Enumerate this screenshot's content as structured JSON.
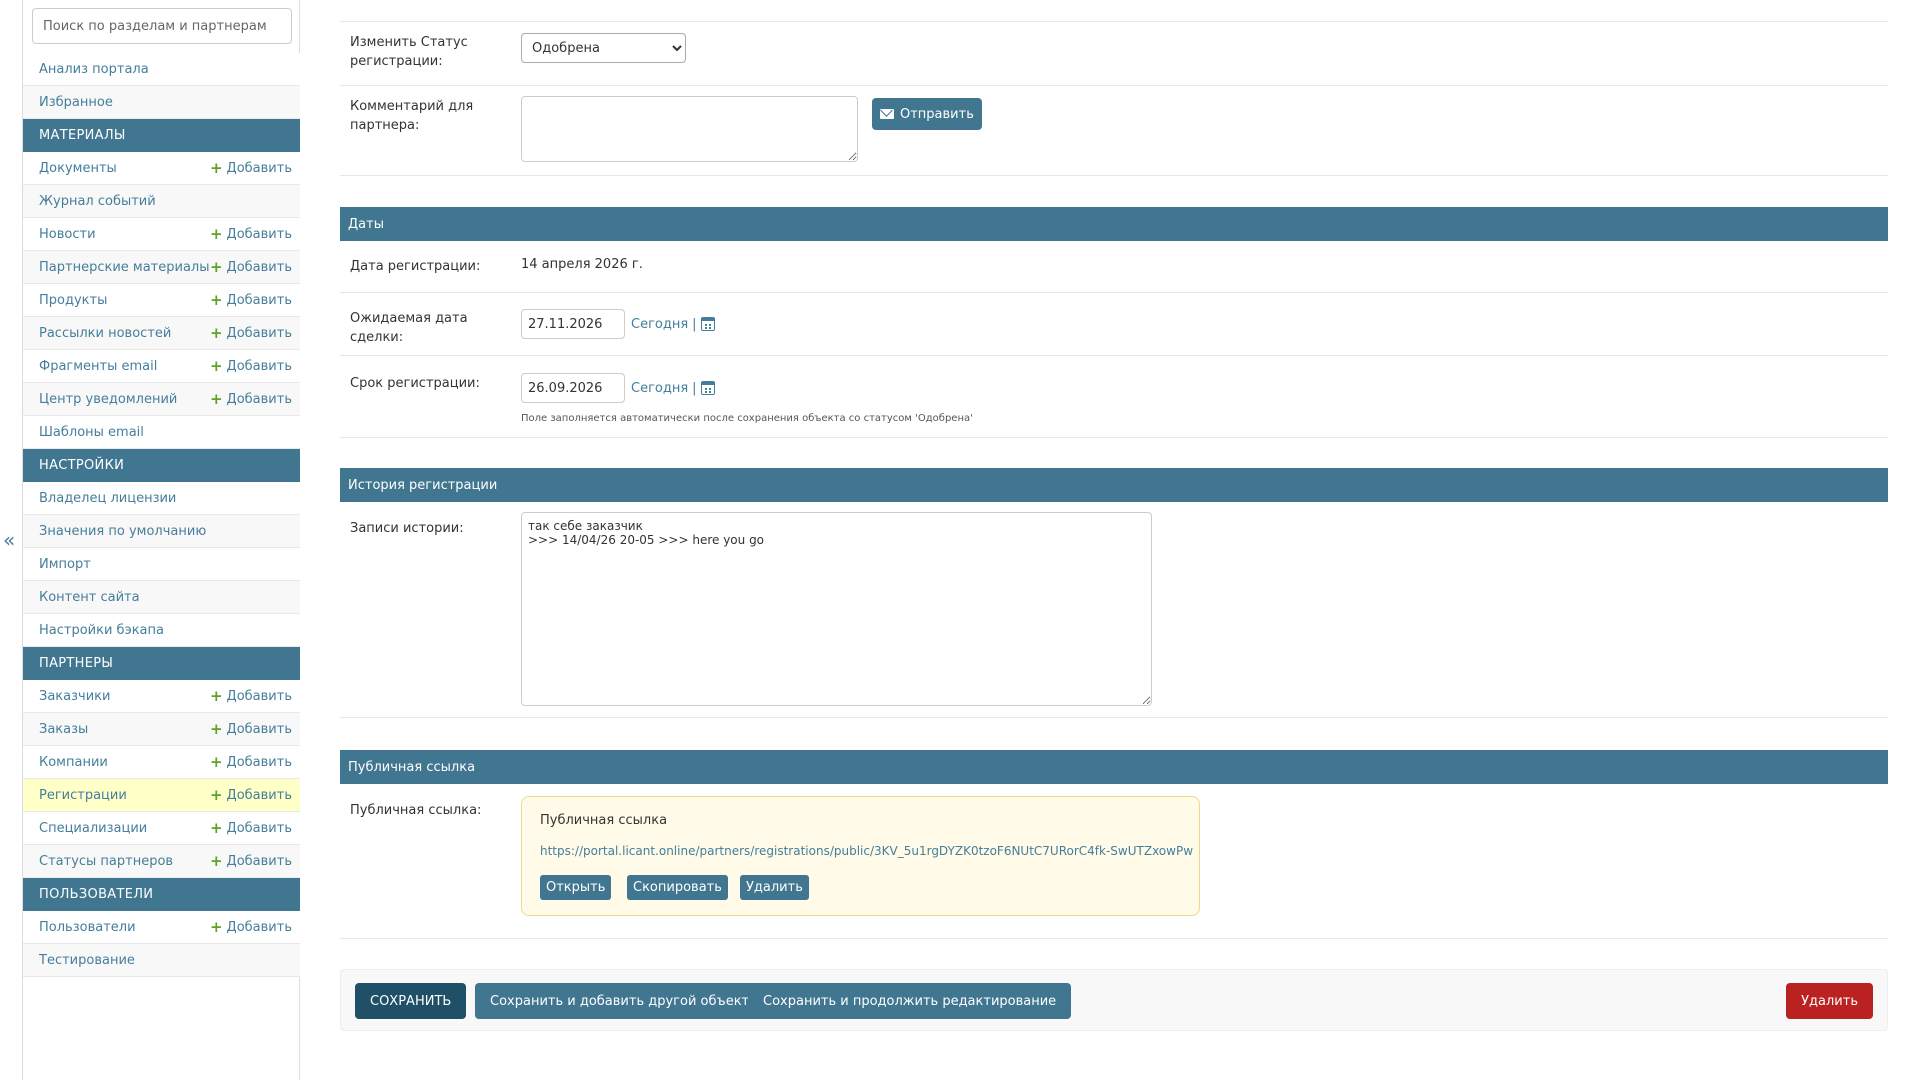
{
  "sidebar": {
    "search_placeholder": "Поиск по разделам и партнерам",
    "collapse_label": "«",
    "add_label": "Добавить",
    "top_items": [
      {
        "label": "Анализ портала"
      },
      {
        "label": "Избранное"
      }
    ],
    "groups": [
      {
        "title": "МАТЕРИАЛЫ",
        "items": [
          {
            "label": "Документы"
          },
          {
            "label": "Журнал событий"
          },
          {
            "label": "Новости"
          },
          {
            "label": "Партнерские материалы"
          },
          {
            "label": "Продукты"
          },
          {
            "label": "Рассылки новостей"
          },
          {
            "label": "Фрагменты email"
          },
          {
            "label": "Центр уведомлений"
          },
          {
            "label": "Шаблоны email"
          }
        ]
      },
      {
        "title": "НАСТРОЙКИ",
        "items": [
          {
            "label": "Владелец лицензии"
          },
          {
            "label": "Значения по умолчанию"
          },
          {
            "label": "Импорт"
          },
          {
            "label": "Контент сайта"
          },
          {
            "label": "Настройки бэкапа"
          }
        ]
      },
      {
        "title": "ПАРТНЕРЫ",
        "items": [
          {
            "label": "Заказчики"
          },
          {
            "label": "Заказы"
          },
          {
            "label": "Компании"
          },
          {
            "label": "Регистрации"
          },
          {
            "label": "Специализации"
          },
          {
            "label": "Статусы партнеров"
          }
        ]
      },
      {
        "title": "ПОЛЬЗОВАТЕЛИ",
        "items": [
          {
            "label": "Пользователи"
          },
          {
            "label": "Тестирование"
          }
        ]
      }
    ]
  },
  "form": {
    "status_label": "Изменить Статус регистрации:",
    "status_value": "Одобрена",
    "comment_label": "Комментарий для партнера:",
    "send_button": "Отправить",
    "dates_section": "Даты",
    "reg_date_label": "Дата регистрации:",
    "reg_date_value": "14 апреля 2026 г.",
    "expected_date_label": "Ожидаемая дата сделки:",
    "expected_date_value": "27.11.2026",
    "today_label": "Сегодня",
    "separator": "|",
    "expiry_label": "Срок регистрации:",
    "expiry_value": "26.09.2026",
    "expiry_help": "Поле заполняется автоматически после сохранения объекта со статусом 'Одобрена'",
    "history_section": "История регистрации",
    "history_label": "Записи истории:",
    "history_value": "так себе заказчик\n>>> 14/04/26 20-05 >>> here you go",
    "public_section": "Публичная ссылка",
    "public_label": "Публичная ссылка:",
    "public_box_title": "Публичная ссылка",
    "public_url": "https://portal.licant.online/partners/registrations/public/3KV_5u1rgDYZK0tzoF6NUtC7URorC4fk-SwUTZxowPw",
    "open_button": "Открыть",
    "copy_button": "Скопировать",
    "delete_link_button": "Удалить"
  },
  "submit": {
    "save": "СОХРАНИТЬ",
    "save_add": "Сохранить и добавить другой объект",
    "save_continue": "Сохранить и продолжить редактирование",
    "delete": "Удалить"
  },
  "colors": {
    "header": "#417690",
    "link": "#447e9b",
    "add_plus": "#5fa225",
    "delete": "#ba2121",
    "save": "#205067"
  }
}
